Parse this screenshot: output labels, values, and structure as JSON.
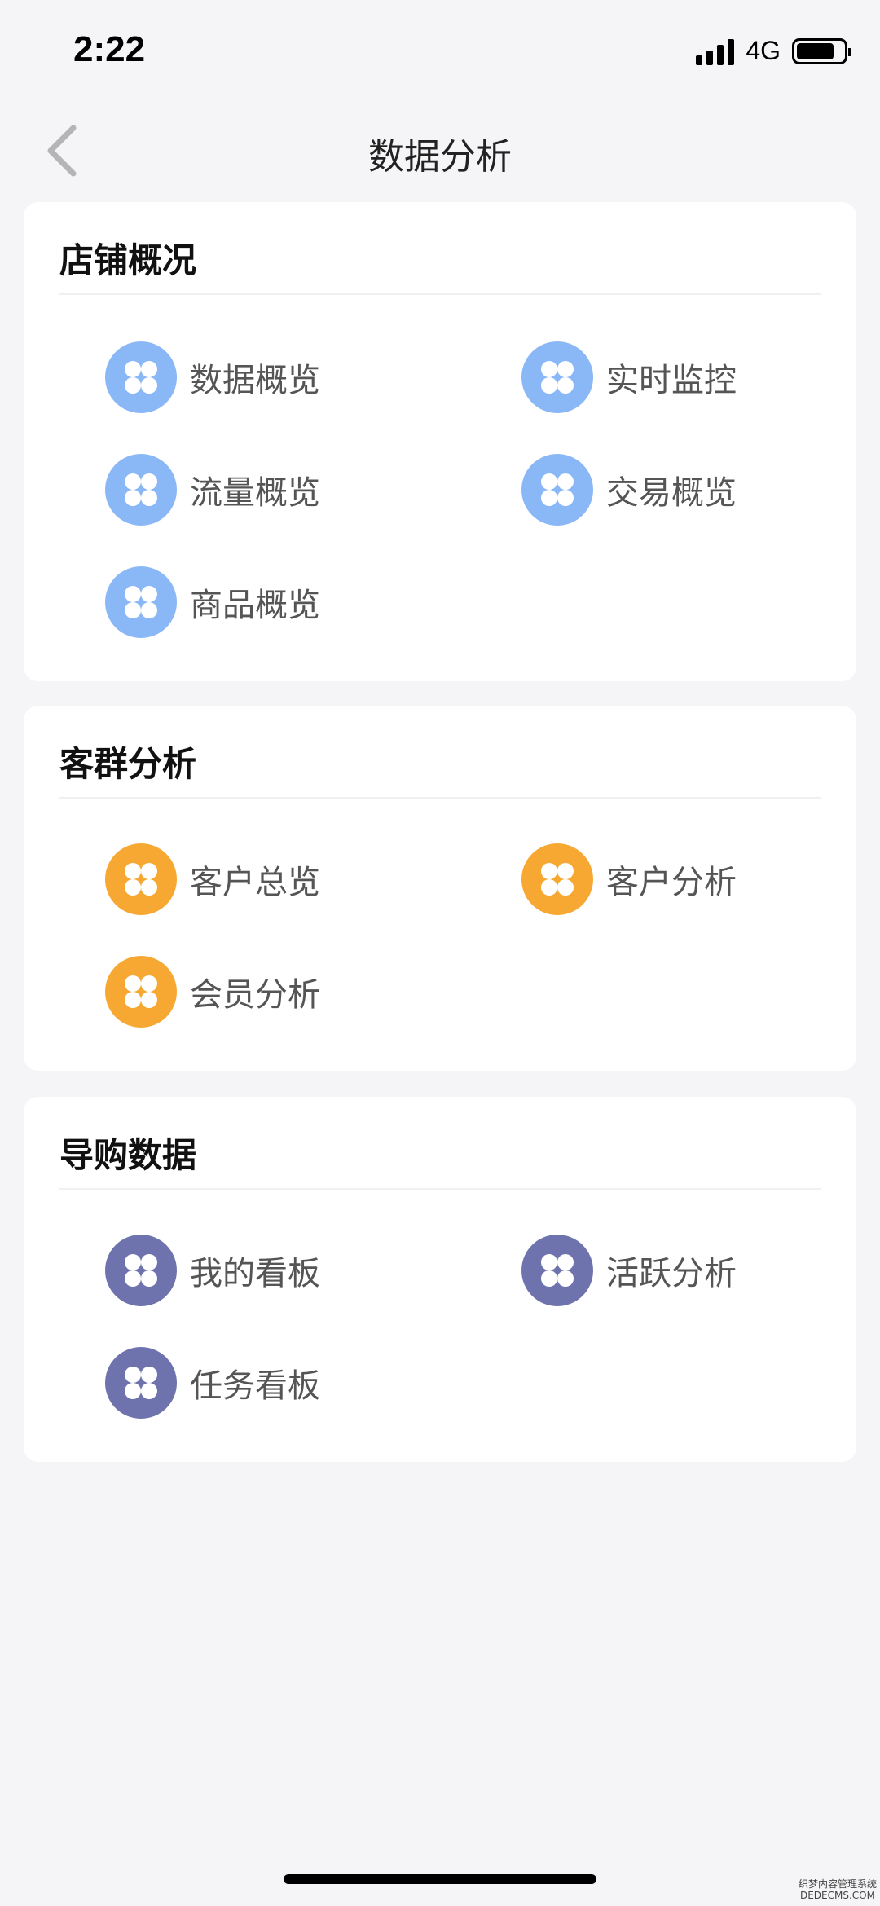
{
  "status_bar": {
    "time": "2:22",
    "network": "4G",
    "battery_level": 0.8
  },
  "nav": {
    "title": "数据分析"
  },
  "icon_colors": {
    "blue": "#8ab7f5",
    "orange": "#f6a832",
    "purple": "#6e73ad"
  },
  "sections": [
    {
      "title": "店铺概况",
      "icon": "clover-icon",
      "color": "#8ab7f5",
      "items": [
        "数据概览",
        "实时监控",
        "流量概览",
        "交易概览",
        "商品概览"
      ]
    },
    {
      "title": "客群分析",
      "icon": "clover-icon",
      "color": "#f6a832",
      "items": [
        "客户总览",
        "客户分析",
        "会员分析"
      ]
    },
    {
      "title": "导购数据",
      "icon": "clover-icon",
      "color": "#6e73ad",
      "items": [
        "我的看板",
        "活跃分析",
        "任务看板"
      ]
    }
  ],
  "watermark": {
    "line1": "织梦内容管理系统",
    "line2": "DEDECMS.COM"
  }
}
